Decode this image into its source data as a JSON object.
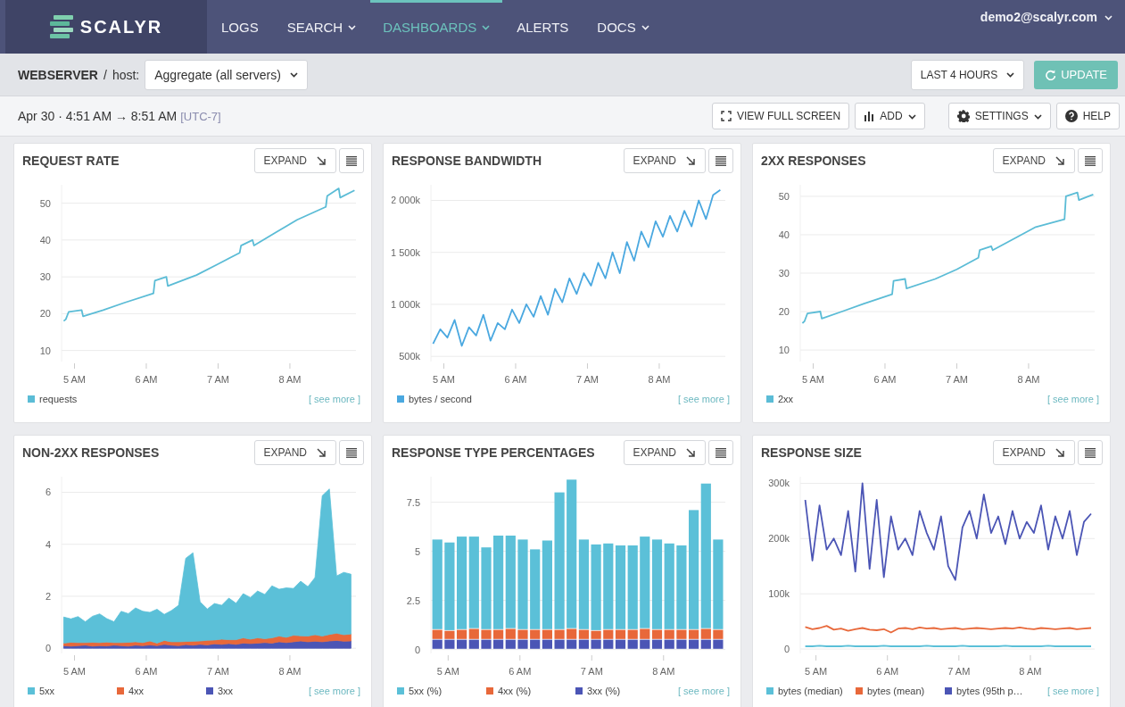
{
  "nav": {
    "logo": "SCALYR",
    "items": [
      {
        "label": "LOGS",
        "selected": false,
        "dropdown": false
      },
      {
        "label": "SEARCH",
        "selected": false,
        "dropdown": true
      },
      {
        "label": "DASHBOARDS",
        "selected": true,
        "dropdown": true
      },
      {
        "label": "ALERTS",
        "selected": false,
        "dropdown": false
      },
      {
        "label": "DOCS",
        "selected": false,
        "dropdown": true
      }
    ],
    "user": "demo2@scalyr.com"
  },
  "toolbar": {
    "dashboard": "WEBSERVER",
    "separator": "/",
    "filter_label": "host:",
    "filter_value": "Aggregate (all servers)",
    "time_range": "LAST 4 HOURS",
    "update": "UPDATE"
  },
  "timebar": {
    "range": "Apr 30 · 4:51 AM → 8:51 AM",
    "timezone": "[UTC-7]",
    "buttons": [
      {
        "kind": "fullscreen",
        "label": "VIEW FULL SCREEN",
        "dropdown": false
      },
      {
        "kind": "add",
        "label": "ADD",
        "dropdown": true
      },
      {
        "kind": "settings",
        "label": "SETTINGS",
        "dropdown": true
      },
      {
        "kind": "help",
        "label": "HELP",
        "dropdown": false
      }
    ]
  },
  "cards": [
    {
      "title": "REQUEST RATE",
      "expand": "EXPAND",
      "see_more": "[ see more ]",
      "chart_data": {
        "type": "line",
        "grid": true,
        "xlim": [
          4.82,
          8.92
        ],
        "ylim": [
          7,
          55
        ],
        "xticks": [
          {
            "value": 5,
            "label": "5 AM"
          },
          {
            "value": 6,
            "label": "6 AM"
          },
          {
            "value": 7,
            "label": "7 AM"
          },
          {
            "value": 8,
            "label": "8 AM"
          }
        ],
        "yticks": [
          10,
          20,
          30,
          40,
          50
        ],
        "x": [
          4.85,
          4.88,
          4.92,
          5.1,
          5.12,
          5.4,
          5.7,
          6.1,
          6.12,
          6.28,
          6.3,
          6.7,
          7.0,
          7.3,
          7.32,
          7.48,
          7.5,
          7.8,
          8.1,
          8.5,
          8.52,
          8.68,
          8.7,
          8.9
        ],
        "series": [
          {
            "name": "requests",
            "color": "#5bbcd6",
            "values": [
              18,
              18.5,
              20.5,
              21,
              19.3,
              21,
              23,
              25.5,
              29,
              30,
              27.5,
              30.5,
              33.5,
              36.5,
              38.5,
              40,
              38.5,
              42,
              45.5,
              49,
              52,
              54,
              51.5,
              53.5
            ]
          }
        ]
      }
    },
    {
      "title": "RESPONSE BANDWIDTH",
      "expand": "EXPAND",
      "see_more": "[ see more ]",
      "chart_data": {
        "type": "line",
        "grid": true,
        "xlim": [
          4.82,
          8.92
        ],
        "ylim": [
          450,
          2150
        ],
        "xticks": [
          {
            "value": 5,
            "label": "5 AM"
          },
          {
            "value": 6,
            "label": "6 AM"
          },
          {
            "value": 7,
            "label": "7 AM"
          },
          {
            "value": 8,
            "label": "8 AM"
          }
        ],
        "yticks": [
          {
            "value": 500,
            "label": "500k"
          },
          {
            "value": 1000,
            "label": "1 000k"
          },
          {
            "value": 1500,
            "label": "1 500k"
          },
          {
            "value": 2000,
            "label": "2 000k"
          }
        ],
        "x": [
          4.85,
          4.95,
          5.05,
          5.15,
          5.25,
          5.35,
          5.45,
          5.55,
          5.65,
          5.75,
          5.85,
          5.95,
          6.05,
          6.15,
          6.25,
          6.35,
          6.45,
          6.55,
          6.65,
          6.75,
          6.85,
          6.95,
          7.05,
          7.15,
          7.25,
          7.35,
          7.45,
          7.55,
          7.65,
          7.75,
          7.85,
          7.95,
          8.05,
          8.15,
          8.25,
          8.35,
          8.45,
          8.55,
          8.65,
          8.75,
          8.85
        ],
        "series": [
          {
            "name": "bytes / second",
            "color": "#4aa8e0",
            "values": [
              620,
              760,
              680,
              850,
              600,
              780,
              700,
              900,
              650,
              820,
              760,
              950,
              820,
              1000,
              880,
              1080,
              900,
              1150,
              1020,
              1250,
              1100,
              1300,
              1180,
              1400,
              1250,
              1500,
              1300,
              1600,
              1420,
              1700,
              1550,
              1800,
              1650,
              1850,
              1700,
              1900,
              1750,
              2000,
              1820,
              2050,
              2100
            ]
          }
        ]
      }
    },
    {
      "title": "2XX RESPONSES",
      "expand": "EXPAND",
      "see_more": "[ see more ]",
      "chart_data": {
        "type": "line",
        "grid": true,
        "xlim": [
          4.82,
          8.92
        ],
        "ylim": [
          7,
          53
        ],
        "xticks": [
          {
            "value": 5,
            "label": "5 AM"
          },
          {
            "value": 6,
            "label": "6 AM"
          },
          {
            "value": 7,
            "label": "7 AM"
          },
          {
            "value": 8,
            "label": "8 AM"
          }
        ],
        "yticks": [
          10,
          20,
          30,
          40,
          50
        ],
        "x": [
          4.85,
          4.88,
          4.92,
          5.1,
          5.12,
          5.4,
          5.7,
          6.1,
          6.12,
          6.28,
          6.3,
          6.7,
          7.0,
          7.3,
          7.32,
          7.48,
          7.5,
          7.8,
          8.1,
          8.5,
          8.52,
          8.68,
          8.7,
          8.9
        ],
        "series": [
          {
            "name": "2xx",
            "color": "#5bbcd6",
            "values": [
              17,
              17.5,
              19.5,
              20,
              18.2,
              20,
              22,
              24.5,
              28,
              28.5,
              26,
              28.5,
              31,
              34,
              36,
              37,
              36,
              39,
              42,
              44,
              50,
              51,
              49,
              50.5
            ]
          }
        ]
      }
    },
    {
      "title": "NON-2XX RESPONSES",
      "expand": "EXPAND",
      "see_more": "[ see more ]",
      "chart_data": {
        "type": "area",
        "stacked": true,
        "grid": true,
        "xlim": [
          4.82,
          8.92
        ],
        "ylim": [
          -0.2,
          6.6
        ],
        "xticks": [
          {
            "value": 5,
            "label": "5 AM"
          },
          {
            "value": 6,
            "label": "6 AM"
          },
          {
            "value": 7,
            "label": "7 AM"
          },
          {
            "value": 8,
            "label": "8 AM"
          }
        ],
        "yticks": [
          0,
          2,
          4,
          6
        ],
        "x": [
          4.85,
          4.95,
          5.05,
          5.15,
          5.25,
          5.35,
          5.45,
          5.55,
          5.65,
          5.75,
          5.85,
          5.95,
          6.05,
          6.15,
          6.25,
          6.35,
          6.45,
          6.55,
          6.65,
          6.75,
          6.85,
          6.95,
          7.05,
          7.15,
          7.25,
          7.35,
          7.45,
          7.55,
          7.65,
          7.75,
          7.85,
          7.95,
          8.05,
          8.15,
          8.25,
          8.35,
          8.45,
          8.55,
          8.65,
          8.75,
          8.85
        ],
        "series": [
          {
            "name": "5xx",
            "color": "#5bc0d8",
            "values": [
              1.0,
              0.9,
              1.0,
              0.8,
              1.0,
              1.1,
              0.9,
              0.8,
              1.2,
              1.1,
              1.3,
              1.2,
              1.1,
              1.3,
              1.0,
              1.2,
              1.4,
              3.2,
              3.4,
              1.5,
              1.2,
              1.4,
              1.3,
              1.6,
              1.4,
              1.7,
              1.6,
              1.8,
              1.7,
              2.0,
              1.8,
              1.9,
              1.8,
              2.1,
              1.9,
              2.2,
              5.4,
              5.6,
              2.2,
              2.4,
              2.3
            ]
          },
          {
            "name": "4xx",
            "color": "#e8683a",
            "values": [
              0.1,
              0.15,
              0.12,
              0.1,
              0.15,
              0.12,
              0.15,
              0.1,
              0.12,
              0.15,
              0.13,
              0.12,
              0.15,
              0.1,
              0.15,
              0.13,
              0.15,
              0.12,
              0.15,
              0.13,
              0.18,
              0.15,
              0.2,
              0.15,
              0.18,
              0.2,
              0.17,
              0.2,
              0.15,
              0.2,
              0.22,
              0.2,
              0.25,
              0.2,
              0.22,
              0.25,
              0.22,
              0.25,
              0.28,
              0.25,
              0.27
            ]
          },
          {
            "name": "3xx",
            "color": "#4b55b5",
            "values": [
              0.1,
              0.08,
              0.1,
              0.12,
              0.08,
              0.1,
              0.09,
              0.12,
              0.1,
              0.08,
              0.12,
              0.1,
              0.13,
              0.1,
              0.15,
              0.12,
              0.1,
              0.14,
              0.12,
              0.15,
              0.13,
              0.17,
              0.15,
              0.18,
              0.15,
              0.2,
              0.18,
              0.2,
              0.22,
              0.2,
              0.25,
              0.22,
              0.25,
              0.28,
              0.25,
              0.27,
              0.25,
              0.28,
              0.3,
              0.27,
              0.28
            ]
          }
        ]
      }
    },
    {
      "title": "RESPONSE TYPE PERCENTAGES",
      "expand": "EXPAND",
      "see_more": "[ see more ]",
      "chart_data": {
        "type": "bar",
        "stacked": true,
        "grid": true,
        "xlim": [
          4.76,
          8.86
        ],
        "ylim": [
          -0.2,
          8.8
        ],
        "xticks": [
          {
            "value": 5,
            "label": "5 AM"
          },
          {
            "value": 6,
            "label": "6 AM"
          },
          {
            "value": 7,
            "label": "7 AM"
          },
          {
            "value": 8,
            "label": "8 AM"
          }
        ],
        "yticks": [
          0,
          2.5,
          5,
          7.5
        ],
        "x": [
          4.85,
          5.02,
          5.19,
          5.36,
          5.53,
          5.7,
          5.87,
          6.04,
          6.21,
          6.38,
          6.55,
          6.72,
          6.89,
          7.06,
          7.23,
          7.4,
          7.57,
          7.74,
          7.91,
          8.08,
          8.25,
          8.42,
          8.59,
          8.76
        ],
        "series": [
          {
            "name": "5xx (%)",
            "color": "#5bc0d8",
            "values": [
              4.6,
              4.5,
              4.75,
              4.7,
              4.2,
              4.8,
              4.75,
              4.6,
              4.1,
              4.55,
              7.0,
              7.6,
              4.6,
              4.4,
              4.4,
              4.3,
              4.3,
              4.7,
              4.6,
              4.4,
              4.3,
              6.1,
              7.4,
              4.6
            ]
          },
          {
            "name": "4xx (%)",
            "color": "#e8683a",
            "values": [
              0.5,
              0.45,
              0.5,
              0.55,
              0.5,
              0.5,
              0.55,
              0.5,
              0.5,
              0.5,
              0.5,
              0.55,
              0.5,
              0.45,
              0.5,
              0.5,
              0.5,
              0.55,
              0.5,
              0.5,
              0.5,
              0.5,
              0.55,
              0.5
            ]
          },
          {
            "name": "3xx (%)",
            "color": "#4b55b5",
            "values": [
              0.5,
              0.5,
              0.5,
              0.5,
              0.5,
              0.5,
              0.5,
              0.5,
              0.5,
              0.5,
              0.5,
              0.5,
              0.5,
              0.5,
              0.5,
              0.5,
              0.5,
              0.5,
              0.5,
              0.5,
              0.5,
              0.5,
              0.5,
              0.5
            ]
          }
        ]
      }
    },
    {
      "title": "RESPONSE SIZE",
      "expand": "EXPAND",
      "see_more": "[ see more ]",
      "chart_data": {
        "type": "line",
        "grid": true,
        "xlim": [
          4.78,
          8.9
        ],
        "ylim": [
          -8,
          312
        ],
        "xticks": [
          {
            "value": 5,
            "label": "5 AM"
          },
          {
            "value": 6,
            "label": "6 AM"
          },
          {
            "value": 7,
            "label": "7 AM"
          },
          {
            "value": 8,
            "label": "8 AM"
          }
        ],
        "yticks": [
          {
            "value": 0,
            "label": "0"
          },
          {
            "value": 100,
            "label": "100k"
          },
          {
            "value": 200,
            "label": "200k"
          },
          {
            "value": 300,
            "label": "300k"
          }
        ],
        "x": [
          4.85,
          4.95,
          5.05,
          5.15,
          5.25,
          5.35,
          5.45,
          5.55,
          5.65,
          5.75,
          5.85,
          5.95,
          6.05,
          6.15,
          6.25,
          6.35,
          6.45,
          6.55,
          6.65,
          6.75,
          6.85,
          6.95,
          7.05,
          7.15,
          7.25,
          7.35,
          7.45,
          7.55,
          7.65,
          7.75,
          7.85,
          7.95,
          8.05,
          8.15,
          8.25,
          8.35,
          8.45,
          8.55,
          8.65,
          8.75,
          8.85
        ],
        "series": [
          {
            "name": "bytes (median)",
            "color": "#5bc0d8",
            "values": [
              5,
              5,
              6,
              5,
              5,
              5,
              6,
              5,
              5,
              5,
              5,
              6,
              5,
              5,
              5,
              5,
              5,
              6,
              5,
              5,
              5,
              5,
              6,
              5,
              5,
              5,
              5,
              5,
              6,
              5,
              5,
              5,
              5,
              5,
              6,
              5,
              5,
              5,
              5,
              5,
              5
            ]
          },
          {
            "name": "bytes (mean)",
            "color": "#e8683a",
            "values": [
              40,
              36,
              38,
              42,
              35,
              37,
              33,
              36,
              38,
              35,
              34,
              36,
              30,
              37,
              38,
              36,
              39,
              37,
              38,
              36,
              37,
              38,
              36,
              37,
              38,
              37,
              36,
              37,
              38,
              37,
              39,
              37,
              36,
              38,
              37,
              36,
              37,
              38,
              36,
              37,
              38
            ]
          },
          {
            "name": "bytes (95th p…",
            "color": "#4b55b5",
            "values": [
              270,
              160,
              260,
              180,
              200,
              170,
              250,
              140,
              300,
              145,
              270,
              130,
              240,
              180,
              200,
              170,
              250,
              210,
              180,
              240,
              150,
              125,
              220,
              250,
              200,
              280,
              210,
              240,
              190,
              250,
              200,
              230,
              210,
              260,
              180,
              240,
              200,
              250,
              170,
              230,
              245
            ]
          }
        ]
      }
    }
  ]
}
